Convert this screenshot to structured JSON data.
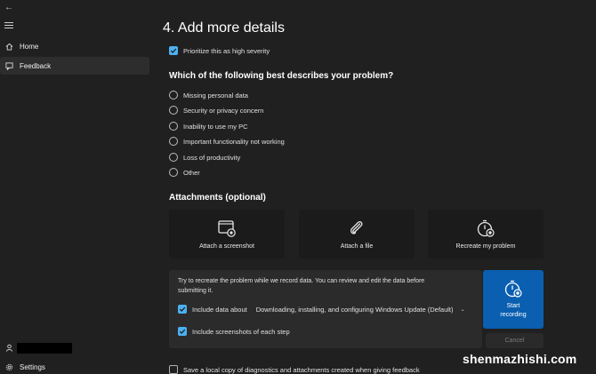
{
  "sidebar": {
    "items": [
      {
        "label": "Home",
        "icon": "home-icon"
      },
      {
        "label": "Feedback",
        "icon": "feedback-icon",
        "selected": true
      }
    ],
    "settings_label": "Settings"
  },
  "main": {
    "title": "4. Add more details",
    "severity_label": "Prioritize this as high severity",
    "severity_checked": true,
    "question": "Which of the following best describes your problem?",
    "options": [
      "Missing personal data",
      "Security or privacy concern",
      "Inability to use my PC",
      "Important functionality not working",
      "Loss of productivity",
      "Other"
    ],
    "attachments_heading": "Attachments (optional)",
    "cards": [
      {
        "label": "Attach a screenshot",
        "icon": "screenshot-icon"
      },
      {
        "label": "Attach a file",
        "icon": "paperclip-icon"
      },
      {
        "label": "Recreate my problem",
        "icon": "stopwatch-icon"
      }
    ],
    "recreate": {
      "instructions": "Try to recreate the problem while we record data. You can review and edit the data before submitting it.",
      "include_data_label": "Include data about",
      "include_data_value": "Downloading, installing, and configuring Windows Update (Default)",
      "include_screenshots_label": "Include screenshots of each step",
      "start_label_1": "Start",
      "start_label_2": "recording",
      "cancel_label": "Cancel"
    },
    "save_copy_label": "Save a local copy of diagnostics and attachments created when giving feedback"
  },
  "watermark": "shenmazhishi.com",
  "colors": {
    "background": "#202020",
    "accent": "#0a5fb0",
    "checkbox": "#4cb0f0"
  }
}
